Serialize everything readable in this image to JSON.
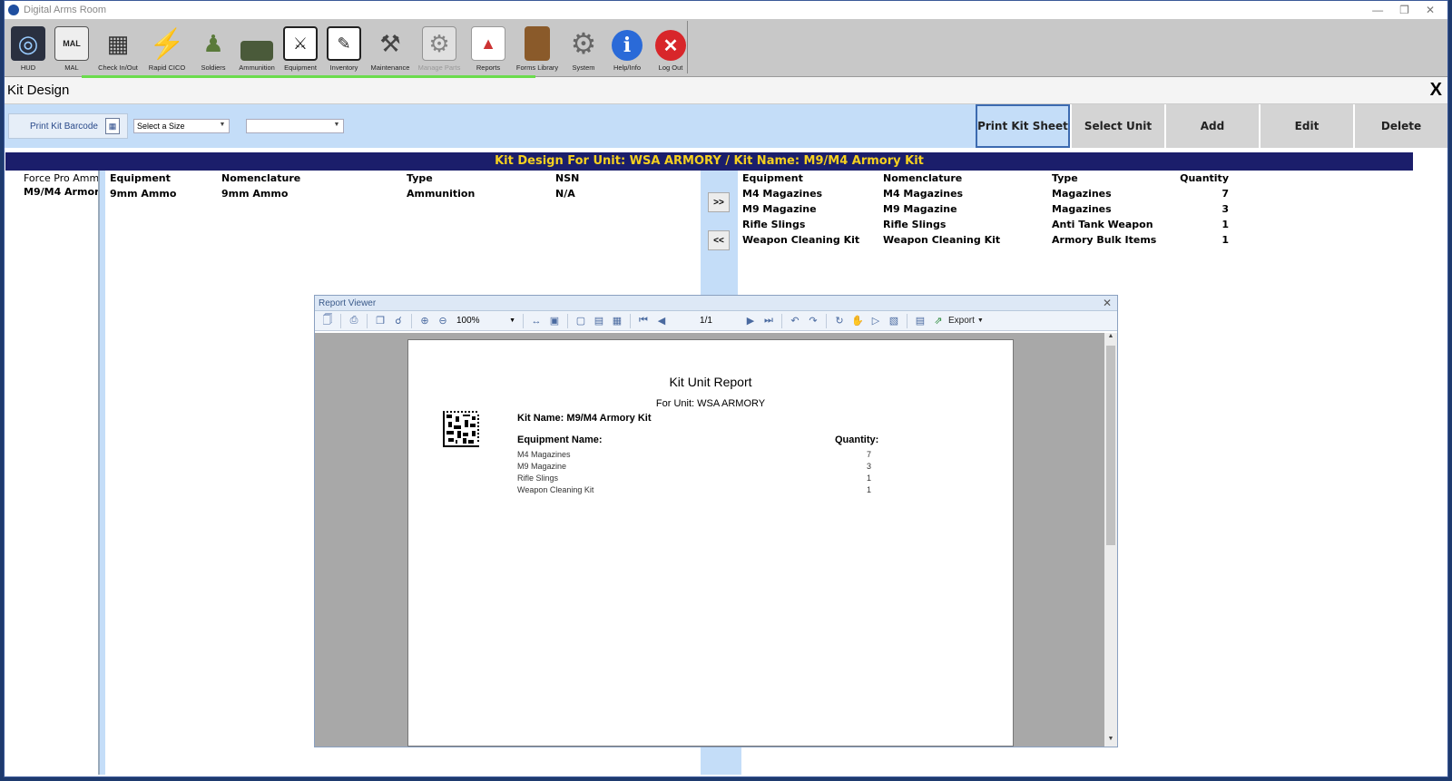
{
  "window": {
    "title": "Digital Arms Room"
  },
  "toolbar": {
    "items": [
      {
        "label": "HUD",
        "icon": "hud-icon"
      },
      {
        "label": "MAL",
        "icon": "mal-icon"
      },
      {
        "label": "Check In/Out",
        "icon": "check-in-out-icon"
      },
      {
        "label": "Rapid CICO",
        "icon": "lightning-icon"
      },
      {
        "label": "Soldiers",
        "icon": "soldier-icon"
      },
      {
        "label": "Ammunition",
        "icon": "ammo-box-icon"
      },
      {
        "label": "Equipment",
        "icon": "equipment-icon"
      },
      {
        "label": "Inventory",
        "icon": "inventory-icon"
      },
      {
        "label": "Maintenance",
        "icon": "tools-icon"
      },
      {
        "label": "Manage Parts",
        "icon": "parts-icon",
        "disabled": true
      },
      {
        "label": "Reports",
        "icon": "reports-icon"
      },
      {
        "label": "Forms Library",
        "icon": "book-icon"
      },
      {
        "label": "System",
        "icon": "gear-icon"
      },
      {
        "label": "Help/Info",
        "icon": "info-icon"
      },
      {
        "label": "Log Out",
        "icon": "close-circle-icon"
      }
    ]
  },
  "page": {
    "title": "Kit Design",
    "close_label": "X"
  },
  "actions": {
    "print_barcode": "Print Kit Barcode",
    "size_placeholder": "Select a Size",
    "second_combo": "",
    "buttons": [
      "Print Kit Sheet",
      "Select Unit",
      "Add",
      "Edit",
      "Delete"
    ]
  },
  "banner": "Kit Design For Unit: WSA ARMORY / Kit Name: M9/M4 Armory Kit",
  "tree": {
    "items": [
      "Force Pro Ammo",
      "M9/M4 Armory Kit"
    ]
  },
  "left_grid": {
    "columns": [
      "Equipment",
      "Nomenclature",
      "Type",
      "NSN"
    ],
    "rows": [
      [
        "9mm Ammo",
        "9mm Ammo",
        "Ammunition",
        "N/A"
      ]
    ]
  },
  "transfer": {
    "add": ">>",
    "remove": "<<"
  },
  "right_grid": {
    "columns": [
      "Equipment",
      "Nomenclature",
      "Type",
      "Quantity"
    ],
    "rows": [
      [
        "M4 Magazines",
        "M4 Magazines",
        "Magazines",
        "7"
      ],
      [
        "M9 Magazine",
        "M9 Magazine",
        "Magazines",
        "3"
      ],
      [
        "Rifle Slings",
        "Rifle Slings",
        "Anti Tank Weapon",
        "1"
      ],
      [
        "Weapon Cleaning Kit",
        "Weapon Cleaning Kit",
        "Armory Bulk Items",
        "1"
      ]
    ]
  },
  "report_viewer": {
    "title": "Report Viewer",
    "zoom": "100%",
    "page": "1/1",
    "export_label": "Export",
    "report": {
      "title": "Kit Unit Report",
      "subtitle": "For Unit: WSA ARMORY",
      "kit_label": "Kit Name:",
      "kit_name": "M9/M4 Armory Kit",
      "equipment_header": "Equipment Name:",
      "quantity_header": "Quantity:",
      "rows": [
        [
          "M4 Magazines",
          "7"
        ],
        [
          "M9 Magazine",
          "3"
        ],
        [
          "Rifle Slings",
          "1"
        ],
        [
          "Weapon Cleaning Kit",
          "1"
        ]
      ]
    }
  }
}
